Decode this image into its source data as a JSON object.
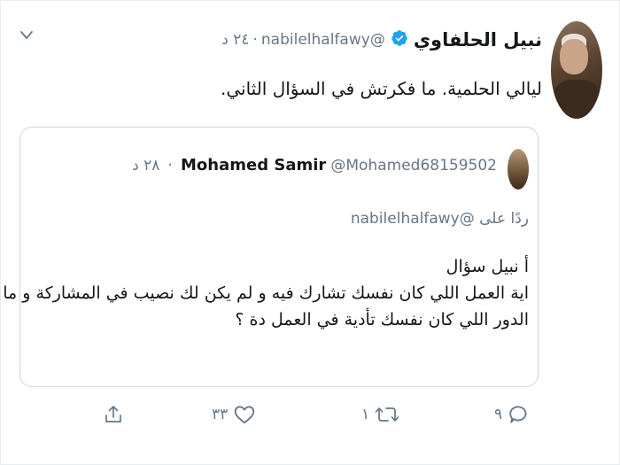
{
  "tweet": {
    "author_name": "نبيل الحلفاوي",
    "author_handle": "@nabilelhalfawy",
    "separator": "·",
    "time": "٢٤ د",
    "text": "ليالي الحلمية. ما فكرتش في السؤال الثاني."
  },
  "quoted_tweet": {
    "author_name": "Mohamed Samir",
    "author_handle": "@Mohamed68159502",
    "separator": "·",
    "time": "٢٨ د",
    "reply_prefix": "ردًا على",
    "reply_to": "@nabilelhalfawy",
    "body_lines": [
      "أ نبيل سؤال",
      "اية العمل اللي كان نفسك تشارك فيه و لم يكن لك نصيب في المشاركة و ما",
      "الدور اللي كان نفسك تأدية في العمل دة ؟"
    ]
  },
  "actions": {
    "reply_count": "٩",
    "retweet_count": "١",
    "like_count": "٣٣"
  },
  "icons": {
    "verified": "verified-badge-icon",
    "menu": "chevron-down-icon",
    "reply": "reply-icon",
    "retweet": "retweet-icon",
    "like": "heart-icon",
    "share": "share-icon"
  },
  "colors": {
    "text": "#14171a",
    "secondary": "#657786",
    "verified": "#1da1f2",
    "border": "#ccd6dd"
  }
}
